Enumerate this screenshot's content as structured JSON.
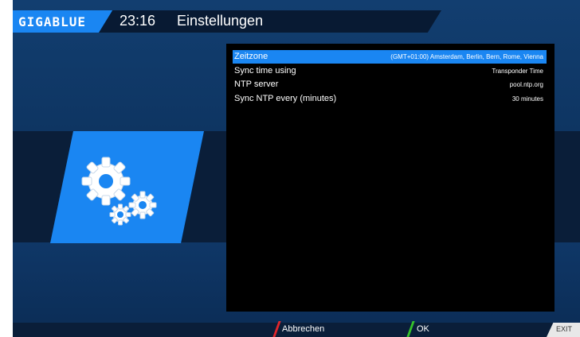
{
  "header": {
    "logo": "GIGABLUE",
    "time": "23:16",
    "title": "Einstellungen"
  },
  "settings": [
    {
      "label": "Zeitzone",
      "value": "(GMT+01:00) Amsterdam, Berlin, Bern, Rome, Vienna",
      "selected": true
    },
    {
      "label": "Sync time using",
      "value": "Transponder Time",
      "selected": false
    },
    {
      "label": "NTP server",
      "value": "pool.ntp.org",
      "selected": false
    },
    {
      "label": "Sync NTP every (minutes)",
      "value": "30 minutes",
      "selected": false
    }
  ],
  "footer": {
    "cancel_label": "Abbrechen",
    "ok_label": "OK",
    "exit_label": "EXIT"
  },
  "colors": {
    "accent": "#1a86f2",
    "red_key": "#e0262b",
    "green_key": "#35c22b"
  },
  "icon": "gears-icon"
}
